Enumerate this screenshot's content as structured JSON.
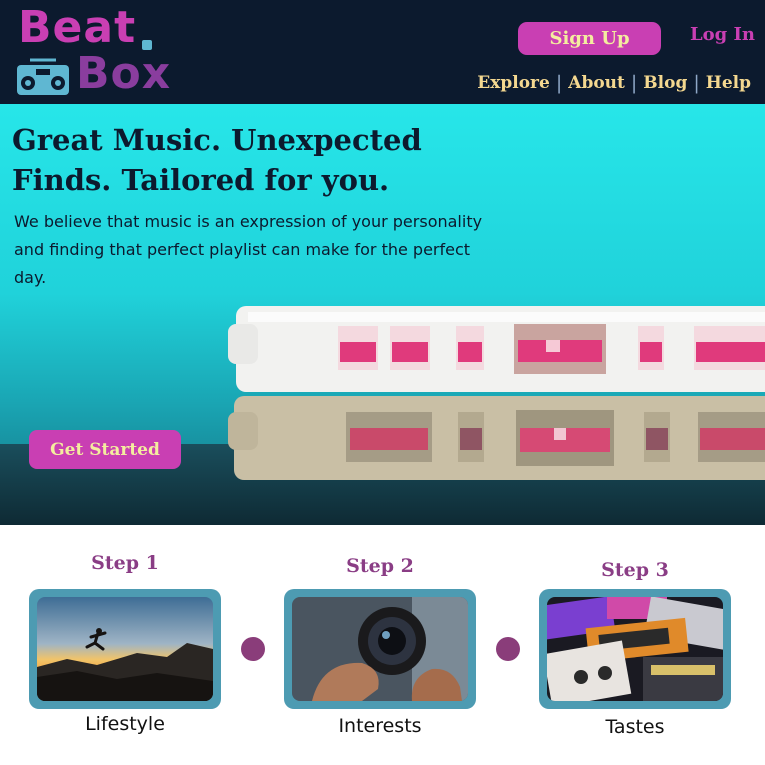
{
  "brand": {
    "line1": "Beat",
    "line2": "Box",
    "icon": "boombox-icon"
  },
  "header": {
    "signup_label": "Sign Up",
    "login_label": "Log In",
    "nav": [
      "Explore",
      "About",
      "Blog",
      "Help"
    ]
  },
  "hero": {
    "title": "Great Music. Unexpected Finds. Tailored for you.",
    "body": "We believe that music is an expression of your personality and finding that perfect playlist can make for the perfect day.",
    "cta_label": "Get Started",
    "image": "cassette-tapes-photo"
  },
  "steps": [
    {
      "title": "Step 1",
      "label": "Lifestyle",
      "image": "person-jumping-sunset-photo"
    },
    {
      "title": "Step 2",
      "label": "Interests",
      "image": "hands-holding-camera-lens-photo"
    },
    {
      "title": "Step 3",
      "label": "Tastes",
      "image": "cassette-collection-photo"
    }
  ],
  "colors": {
    "header_bg": "#0c1a2e",
    "accent": "#c93fb3",
    "accent_text": "#f4ed9f",
    "nav_text": "#f4d890",
    "hero_cyan": "#27e6e9",
    "step_title": "#8a3d85",
    "frame": "#4d9bb2"
  }
}
